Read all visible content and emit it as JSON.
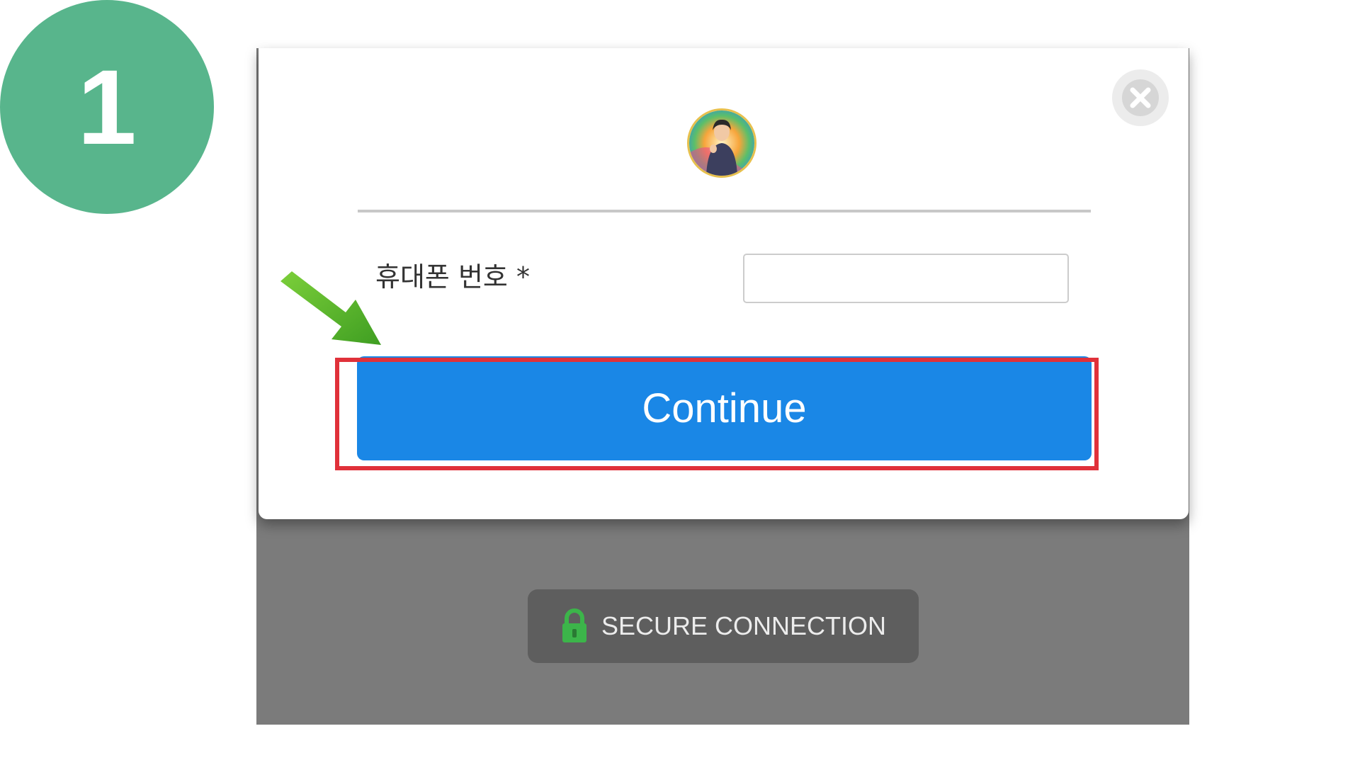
{
  "step": {
    "number": "1"
  },
  "modal": {
    "phone_label": "휴대폰 번호 *",
    "phone_value": "",
    "continue_label": "Continue"
  },
  "footer": {
    "secure_label": "SECURE CONNECTION"
  },
  "icons": {
    "close": "close-icon",
    "lock": "lock-icon",
    "arrow": "arrow-icon"
  },
  "colors": {
    "badge": "#58b58c",
    "button": "#1a87e6",
    "highlight": "#e0313a",
    "lock": "#3cb54a",
    "arrow": "#4caf28",
    "backdrop": "#7b7b7b"
  }
}
